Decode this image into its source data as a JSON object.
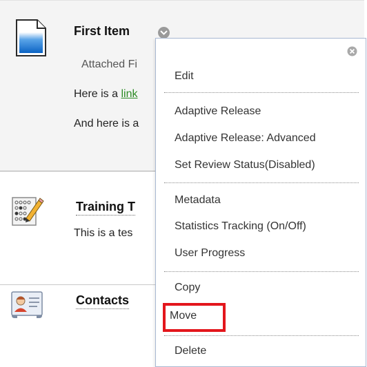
{
  "items": [
    {
      "title": "First Item",
      "attached": "Attached Fi",
      "line1_prefix": "Here is a ",
      "line1_link": "link",
      "line2": "And here is a",
      "icon": "document-icon"
    },
    {
      "title": "Training T",
      "description": "This is a tes",
      "icon": "test-pencil-icon"
    },
    {
      "title": "Contacts",
      "icon": "contact-card-icon"
    }
  ],
  "menu": {
    "close_icon": "close-circle-icon",
    "items": [
      "Edit",
      "Adaptive Release",
      "Adaptive Release: Advanced",
      "Set Review Status(Disabled)",
      "Metadata",
      "Statistics Tracking (On/Off)",
      "User Progress",
      "Copy",
      "Move",
      "Delete"
    ],
    "highlighted_item": "Move"
  },
  "colors": {
    "menu_border": "#a8b8d2",
    "highlight": "#e3161c",
    "link": "#2c8a25",
    "row_selected_bg": "#f4f4f4"
  }
}
